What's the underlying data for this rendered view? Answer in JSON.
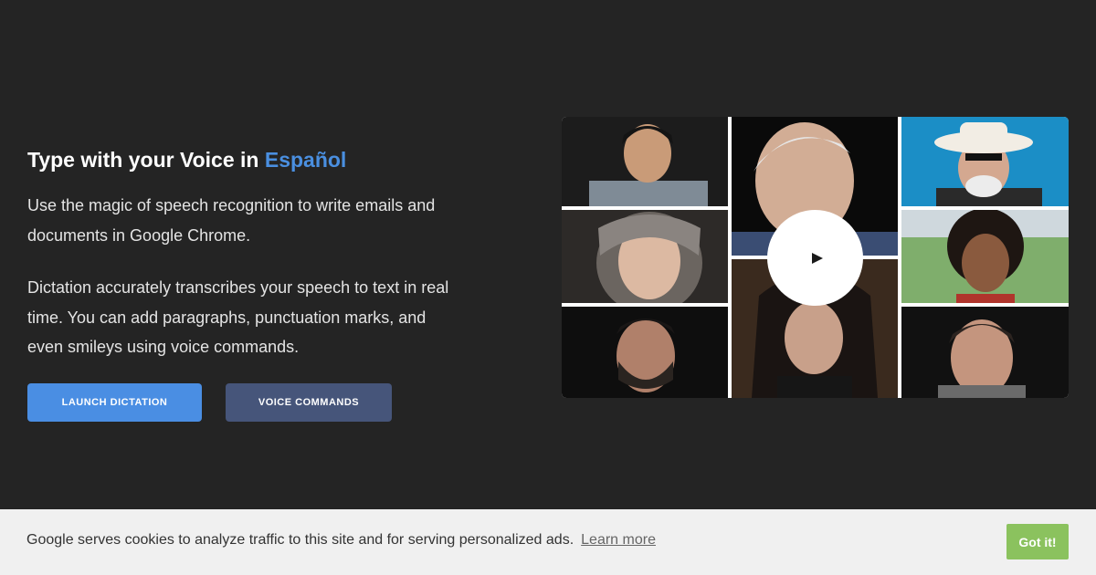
{
  "hero": {
    "headline_prefix": "Type with your Voice in ",
    "headline_language": "Español",
    "paragraph_1": "Use the magic of speech recognition to write emails and documents in Google Chrome.",
    "paragraph_2": "Dictation accurately transcribes your speech to text in real time. You can add paragraphs, punctuation marks, and even smileys using voice commands.",
    "launch_button_label": "LAUNCH DICTATION",
    "voice_commands_button_label": "VOICE COMMANDS"
  },
  "video": {
    "play_icon": "play-icon",
    "portraits": [
      "young-man",
      "elderly-man",
      "man-in-cowboy-hat",
      "woman-in-headscarf",
      "woman-curly-hair",
      "smiling-bearded-man",
      "dark-haired-woman",
      "man-short-hair"
    ]
  },
  "cookie_banner": {
    "message": "Google serves cookies to analyze traffic to this site and for serving personalized ads.",
    "learn_more_label": "Learn more",
    "accept_label": "Got it!"
  },
  "colors": {
    "background": "#242424",
    "accent_blue": "#4a8fe0",
    "launch_button": "#4a8ee3",
    "voice_button": "#46557a",
    "accept_green": "#8bc25e",
    "cookie_bar": "#f0f0f0"
  }
}
